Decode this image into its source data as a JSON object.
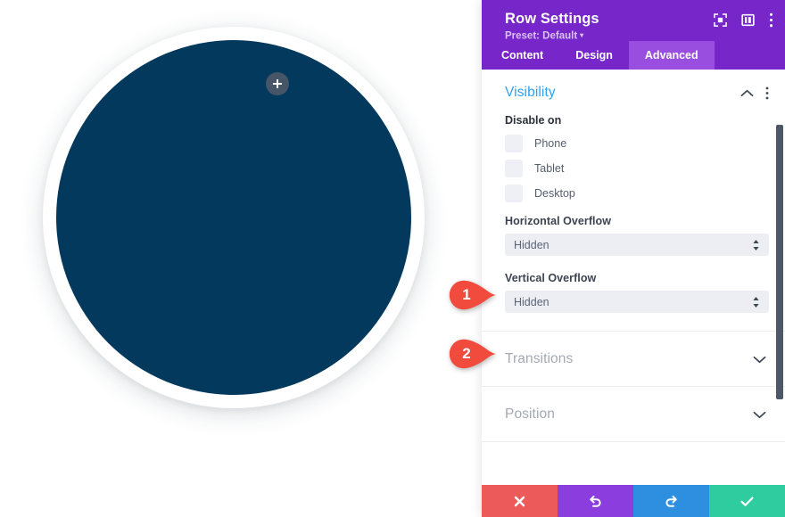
{
  "canvas": {
    "shape_name": "row-circle-shape",
    "shape_color": "#04395e",
    "ring_color": "#ffffff",
    "add_button_label": "+"
  },
  "panel": {
    "title": "Row Settings",
    "preset": "Preset: Default",
    "preset_caret": "▾",
    "header_icons": [
      {
        "name": "expand-icon"
      },
      {
        "name": "layout-icon"
      },
      {
        "name": "more-options-icon"
      }
    ],
    "tabs": [
      {
        "label": "Content",
        "active": false
      },
      {
        "label": "Design",
        "active": false
      },
      {
        "label": "Advanced",
        "active": true
      }
    ],
    "sections": [
      {
        "title": "Visibility",
        "state": "expanded",
        "chevron": "chevron-up-icon"
      },
      {
        "title": "Transitions",
        "state": "collapsed",
        "chevron": "chevron-down-icon"
      },
      {
        "title": "Position",
        "state": "collapsed",
        "chevron": "chevron-down-icon"
      }
    ],
    "visibility": {
      "disable_on_label": "Disable on",
      "devices": [
        {
          "label": "Phone",
          "checked": false
        },
        {
          "label": "Tablet",
          "checked": false
        },
        {
          "label": "Desktop",
          "checked": false
        }
      ],
      "horizontal_overflow": {
        "label": "Horizontal Overflow",
        "value": "Hidden"
      },
      "vertical_overflow": {
        "label": "Vertical Overflow",
        "value": "Hidden"
      }
    },
    "footer": [
      {
        "name": "cancel-button",
        "icon": "close-icon",
        "color": "#ed5a5a"
      },
      {
        "name": "undo-button",
        "icon": "undo-icon",
        "color": "#8b3edd"
      },
      {
        "name": "redo-button",
        "icon": "redo-icon",
        "color": "#2e8fe0"
      },
      {
        "name": "save-button",
        "icon": "check-icon",
        "color": "#2ecc9f"
      }
    ],
    "accent_purple": "#7626c9",
    "accent_blue": "#2ea3f2"
  },
  "callouts": [
    {
      "number": "1",
      "color": "#f04b3c",
      "target": "horizontal-overflow-select"
    },
    {
      "number": "2",
      "color": "#f04b3c",
      "target": "vertical-overflow-select"
    }
  ]
}
